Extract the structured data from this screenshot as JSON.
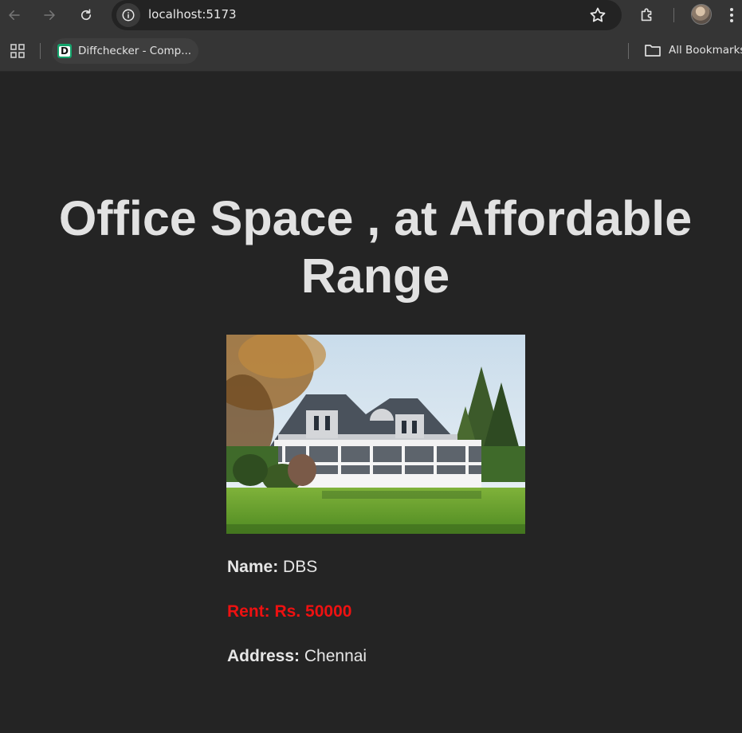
{
  "browser": {
    "url": "localhost:5173",
    "bookmarks": [
      {
        "label": "Diffchecker - Comp...",
        "favicon_letter": "D",
        "favicon_color": "#13a36b"
      }
    ],
    "all_bookmarks_label": "All Bookmarks"
  },
  "page": {
    "heading": "Office Space , at Affordable Range",
    "image_alt": "house",
    "name_label": "Name:",
    "name_value": "DBS",
    "rent_label": "Rent:",
    "rent_value": "Rs. 50000",
    "rent_color": "#ee1111",
    "address_label": "Address:",
    "address_value": "Chennai"
  },
  "theme": {
    "page_bg": "#242424",
    "chrome_bg": "#353535",
    "text": "#e2e2e2"
  }
}
